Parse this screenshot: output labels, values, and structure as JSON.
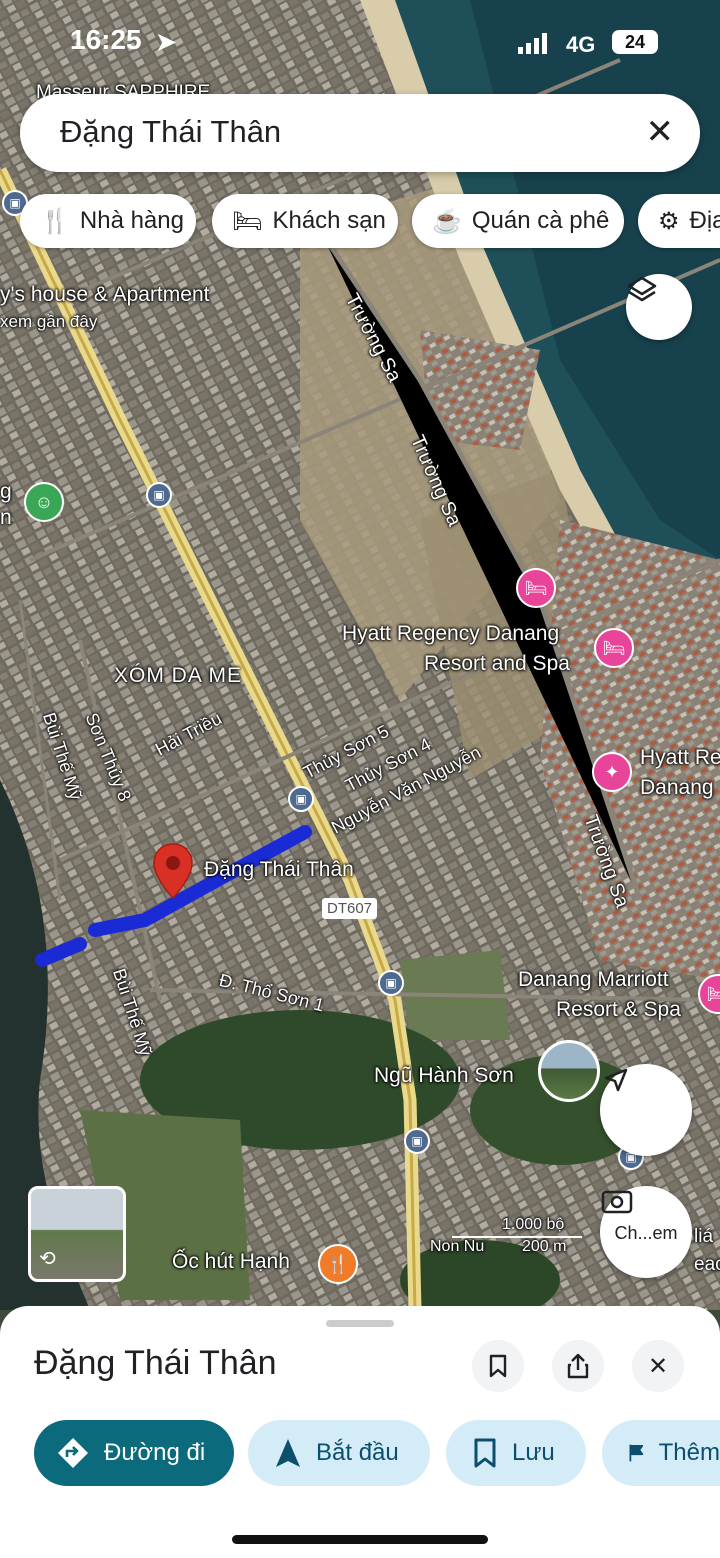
{
  "status": {
    "time": "16:25",
    "network": "4G",
    "battery": "24"
  },
  "search": {
    "query": "Đặng Thái Thân"
  },
  "chips": [
    {
      "icon": "fork-knife-icon",
      "label": "Nhà hàng"
    },
    {
      "icon": "bed-icon",
      "label": "Khách sạn"
    },
    {
      "icon": "coffee-cup-icon",
      "label": "Quán cà phê"
    },
    {
      "icon": "landmark-icon",
      "label": "Địa"
    }
  ],
  "map": {
    "labels": {
      "top_partial": "Masseur SAPPHIRE",
      "house": "y's house & Apartment",
      "house_sub": "xem gần đây",
      "left_edge_1": "g",
      "left_edge_2": "n",
      "xom": "XÓM DA ME",
      "bui_the_my_1": "Bùi Thế Mỹ",
      "son_thuy_8": "Sơn Thủy 8",
      "hai_trieu": "Hải Triều",
      "thuy_son_5": "Thủy Sơn 5",
      "thuy_son_4": "Thủy Sơn 4",
      "nguyen_van_nguyen": "Nguyễn Văn Nguyễn",
      "dang_thai_than": "Đặng Thái Thân",
      "dt607": "DT607",
      "tho_son": "Đ. Thổ Sơn 1",
      "bui_the_my_2": "Bùi Thế Mỹ",
      "truong_sa_1": "Trường Sa",
      "truong_sa_2": "Trường Sa",
      "truong_sa_3": "Trường Sa",
      "hyatt_1": "Hyatt Regency Danang",
      "hyatt_2": "Resort and Spa",
      "hyatt_right_1": "Hyatt Re",
      "hyatt_right_2": "Danang",
      "marriott_1": "Danang Marriott",
      "marriott_2": "Resort & Spa",
      "ngu_hanh_son": "Ngũ Hành Sơn",
      "oc_hut": "Ốc hút Hạnh",
      "scale_ft": "1.000 bộ",
      "scale_m": "200 m",
      "nom_partial": "Non Nu",
      "right_partial_1": "liá",
      "right_partial_2": "each",
      "camera_label": "Ch...em"
    }
  },
  "sheet": {
    "title": "Đặng Thái Thân",
    "actions": [
      {
        "icon": "directions-icon",
        "label": "Đường đi"
      },
      {
        "icon": "navigation-arrow-icon",
        "label": "Bắt đầu"
      },
      {
        "icon": "bookmark-icon",
        "label": "Lưu"
      },
      {
        "icon": "flag-icon",
        "label": "Thêm"
      }
    ]
  },
  "colors": {
    "route": "#1a2bd6",
    "pin": "#d93025",
    "hotel_pin": "#e8449a",
    "food_pin": "#f07c2a",
    "primary_button": "#0b6b7d"
  }
}
